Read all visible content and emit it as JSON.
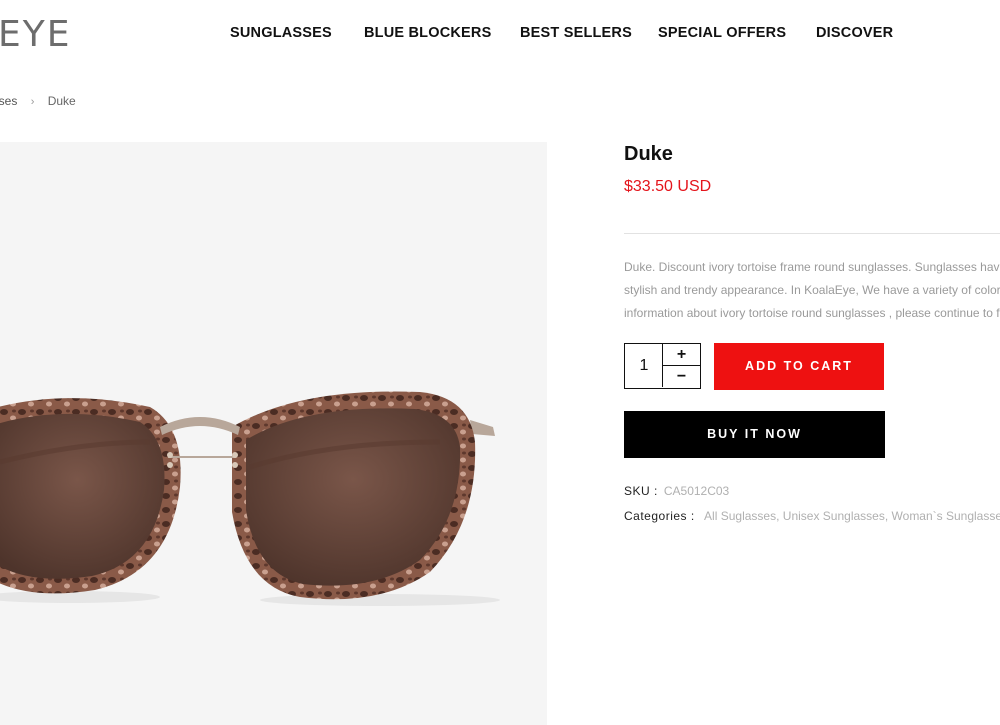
{
  "brand": {
    "logo_text": "EYE"
  },
  "nav": {
    "items": [
      {
        "label": "SUNGLASSES"
      },
      {
        "label": "BLUE BLOCKERS"
      },
      {
        "label": "BEST SELLERS"
      },
      {
        "label": "SPECIAL OFFERS"
      },
      {
        "label": "DISCOVER"
      }
    ]
  },
  "breadcrumb": {
    "items": [
      {
        "label": "asses"
      },
      {
        "label": "Duke"
      }
    ],
    "separator": "›"
  },
  "product": {
    "title": "Duke",
    "price": "$33.50 USD",
    "description": [
      "Duke. Discount ivory tortoise frame round sunglasses. Sunglasses have ar",
      "stylish and trendy appearance. In KoalaEye, We have a variety of colors ar",
      "information about ivory tortoise round sunglasses , please continue to fol"
    ],
    "quantity": "1",
    "qty_plus": "+",
    "qty_minus": "−",
    "add_to_cart_label": "ADD TO CART",
    "buy_now_label": "BUY IT NOW",
    "sku_label": "SKU :",
    "sku_value": "CA5012C03",
    "categories_label": "Categories :",
    "categories": [
      {
        "label": "All Suglasses"
      },
      {
        "label": "Unisex Sunglasses"
      },
      {
        "label": "Woman`s Sunglasses"
      }
    ],
    "category_separator": ","
  },
  "colors": {
    "accent_red": "#ee1111",
    "price_red": "#e4141b",
    "gallery_bg": "#f5f5f5",
    "lens": "#6b4a3e",
    "frame_tortoise": "#7a4e40"
  }
}
